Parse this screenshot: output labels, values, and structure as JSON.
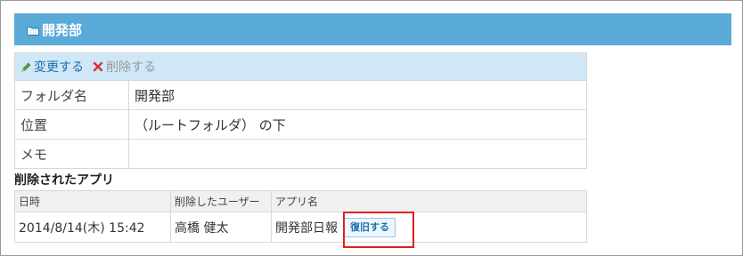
{
  "header": {
    "title": "開発部"
  },
  "toolbar": {
    "edit_label": "変更する",
    "delete_label": "削除する"
  },
  "folder_info": {
    "rows": [
      {
        "label": "フォルダ名",
        "value": "開発部"
      },
      {
        "label": "位置",
        "value": "（ルートフォルダ） の下"
      },
      {
        "label": "メモ",
        "value": ""
      }
    ]
  },
  "deleted_apps": {
    "title": "削除されたアプリ",
    "columns": [
      "日時",
      "削除したユーザー",
      "アプリ名"
    ],
    "rows": [
      {
        "datetime": "2014/8/14(木) 15:42",
        "user": "高橋 健太",
        "app": "開発部日報",
        "restore_label": "復旧する"
      }
    ]
  },
  "colors": {
    "header_bg": "#5aaad8",
    "toolbar_bg": "#cfe7f7",
    "highlight": "#e02020"
  },
  "icons": {
    "header": "folder-icon",
    "edit": "pencil-icon",
    "delete": "x-icon"
  }
}
